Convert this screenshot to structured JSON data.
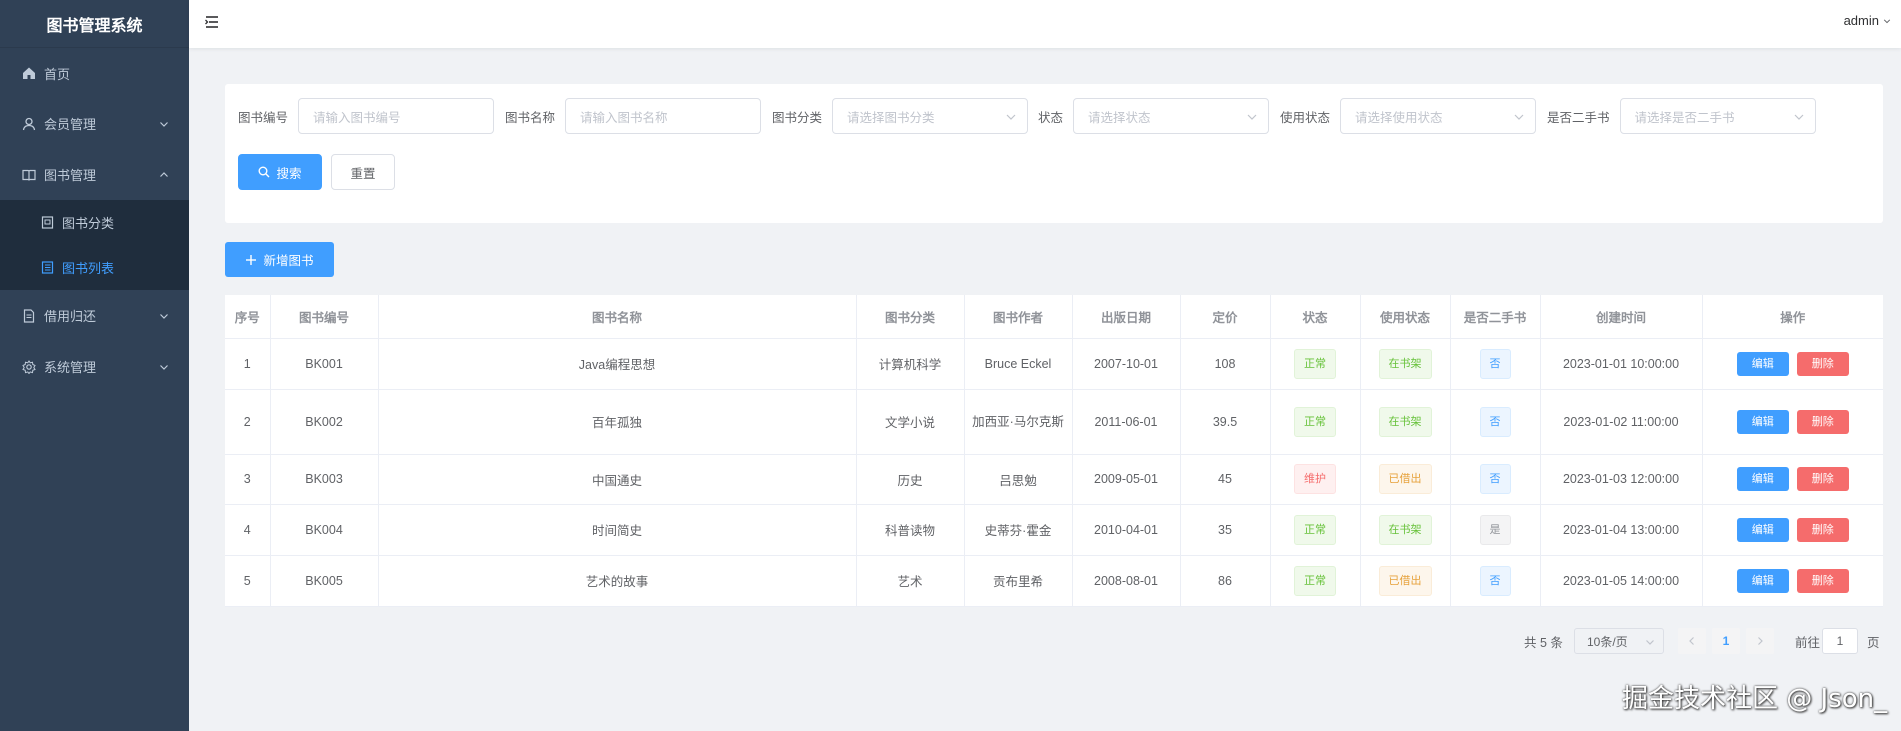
{
  "app": {
    "title": "图书管理系统"
  },
  "header": {
    "user": "admin"
  },
  "sidebar": {
    "items": [
      {
        "label": "首页",
        "icon": "home-icon"
      },
      {
        "label": "会员管理",
        "icon": "user-icon"
      },
      {
        "label": "图书管理",
        "icon": "book-icon"
      },
      {
        "label": "图书分类",
        "icon": "category-icon"
      },
      {
        "label": "图书列表",
        "icon": "list-icon"
      },
      {
        "label": "借用归还",
        "icon": "document-icon"
      },
      {
        "label": "系统管理",
        "icon": "gear-icon"
      }
    ]
  },
  "search": {
    "book_no": {
      "label": "图书编号",
      "placeholder": "请输入图书编号"
    },
    "book_name": {
      "label": "图书名称",
      "placeholder": "请输入图书名称"
    },
    "category": {
      "label": "图书分类",
      "placeholder": "请选择图书分类"
    },
    "status": {
      "label": "状态",
      "placeholder": "请选择状态"
    },
    "use_status": {
      "label": "使用状态",
      "placeholder": "请选择使用状态"
    },
    "second_hand": {
      "label": "是否二手书",
      "placeholder": "请选择是否二手书"
    },
    "search_label": "搜索",
    "reset_label": "重置"
  },
  "toolbar": {
    "add_label": "新增图书"
  },
  "table": {
    "headers": [
      "序号",
      "图书编号",
      "图书名称",
      "图书分类",
      "图书作者",
      "出版日期",
      "定价",
      "状态",
      "使用状态",
      "是否二手书",
      "创建时间",
      "操作"
    ],
    "edit_label": "编辑",
    "delete_label": "删除",
    "rows": [
      {
        "idx": "1",
        "no": "BK001",
        "name": "Java编程思想",
        "category": "计算机科学",
        "author": "Bruce Eckel",
        "date": "2007-10-01",
        "price": "108",
        "status": "正常",
        "use_status": "在书架",
        "second": "否",
        "created": "2023-01-01 10:00:00"
      },
      {
        "idx": "2",
        "no": "BK002",
        "name": "百年孤独",
        "category": "文学小说",
        "author": "加西亚·马尔克斯",
        "date": "2011-06-01",
        "price": "39.5",
        "status": "正常",
        "use_status": "在书架",
        "second": "否",
        "created": "2023-01-02 11:00:00"
      },
      {
        "idx": "3",
        "no": "BK003",
        "name": "中国通史",
        "category": "历史",
        "author": "吕思勉",
        "date": "2009-05-01",
        "price": "45",
        "status": "维护",
        "use_status": "已借出",
        "second": "否",
        "created": "2023-01-03 12:00:00"
      },
      {
        "idx": "4",
        "no": "BK004",
        "name": "时间简史",
        "category": "科普读物",
        "author": "史蒂芬·霍金",
        "date": "2010-04-01",
        "price": "35",
        "status": "正常",
        "use_status": "在书架",
        "second": "是",
        "created": "2023-01-04 13:00:00"
      },
      {
        "idx": "5",
        "no": "BK005",
        "name": "艺术的故事",
        "category": "艺术",
        "author": "贡布里希",
        "date": "2008-08-01",
        "price": "86",
        "status": "正常",
        "use_status": "已借出",
        "second": "否",
        "created": "2023-01-05 14:00:00"
      }
    ]
  },
  "pagination": {
    "total": "共 5 条",
    "page_size": "10条/页",
    "current": "1",
    "goto_prefix": "前往",
    "goto_value": "1",
    "goto_suffix": "页"
  },
  "watermark": "掘金技术社区 @ Json_",
  "colors": {
    "primary": "#409eff",
    "danger": "#f56c6c",
    "success": "#67c23a",
    "warning": "#e6a23c",
    "sidebar_bg": "#304156"
  }
}
